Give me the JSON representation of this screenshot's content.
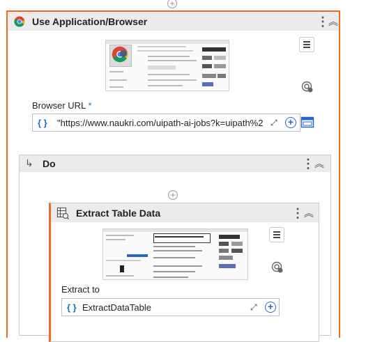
{
  "use_app": {
    "title": "Use Application/Browser",
    "browser_url_label": "Browser URL",
    "required_marker": "*",
    "url_value": "\"https://www.naukri.com/uipath-ai-jobs?k=uipath%2",
    "brace_symbol": "{ }"
  },
  "do_block": {
    "title": "Do"
  },
  "extract": {
    "title": "Extract Table Data",
    "extract_to_label": "Extract to",
    "value": "ExtractDataTable",
    "brace_symbol": "{ }"
  },
  "colors": {
    "accent": "#f26a21",
    "header_bg": "#ebebeb",
    "link_blue": "#1a6fc4"
  }
}
